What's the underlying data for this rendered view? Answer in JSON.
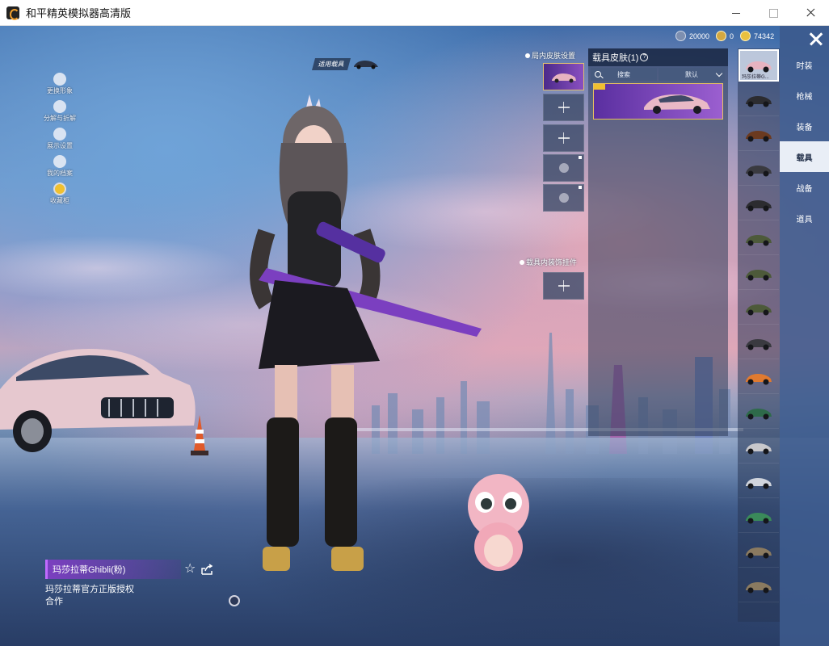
{
  "window": {
    "title": "和平精英模拟器高清版"
  },
  "currency": {
    "coupon": "20000",
    "points": "0",
    "coins": "74342"
  },
  "left_menu": [
    {
      "label": "更换形象",
      "icon": "person-icon"
    },
    {
      "label": "分解与折解",
      "icon": "puzzle-icon"
    },
    {
      "label": "展示设置",
      "icon": "eye-icon"
    },
    {
      "label": "我的档案",
      "icon": "fire-icon"
    },
    {
      "label": "收藏柜",
      "icon": "badge-icon"
    }
  ],
  "applicable_vehicle": {
    "label": "适用载具"
  },
  "slot_panel": {
    "title": "局内皮肤设置",
    "section2_title": "载具内装饰挂件"
  },
  "skin_panel": {
    "title": "载具皮肤(1)",
    "search_label": "搜索",
    "sort_label": "默认"
  },
  "categories": [
    {
      "label": "时装"
    },
    {
      "label": "枪械"
    },
    {
      "label": "装备"
    },
    {
      "label": "载具",
      "active": true
    },
    {
      "label": "战备"
    },
    {
      "label": "道具"
    }
  ],
  "vehicles": [
    {
      "name": "玛莎拉蒂G...",
      "icon": "sports-car-icon",
      "selected": true
    },
    {
      "name": "",
      "icon": "motorcycle-icon"
    },
    {
      "name": "",
      "icon": "horse-icon"
    },
    {
      "name": "",
      "icon": "atv-icon"
    },
    {
      "name": "",
      "icon": "motorbike-icon"
    },
    {
      "name": "",
      "icon": "jeep-icon"
    },
    {
      "name": "",
      "icon": "jeep-icon"
    },
    {
      "name": "",
      "icon": "jeep-icon"
    },
    {
      "name": "",
      "icon": "monster-truck-icon"
    },
    {
      "name": "",
      "icon": "orange-car-icon"
    },
    {
      "name": "",
      "icon": "green-car-icon"
    },
    {
      "name": "",
      "icon": "sedan-icon"
    },
    {
      "name": "",
      "icon": "buggy-icon"
    },
    {
      "name": "",
      "icon": "bus-icon"
    },
    {
      "name": "",
      "icon": "pickup-icon"
    },
    {
      "name": "",
      "icon": "pickup-icon"
    }
  ],
  "item": {
    "name": "玛莎拉蒂Ghibli(粉)",
    "description": "玛莎拉蒂官方正版授权合作"
  },
  "colors": {
    "accent_purple": "#7b3fc0",
    "panel_blue": "#3c5a8c",
    "gold": "#f0c030"
  }
}
